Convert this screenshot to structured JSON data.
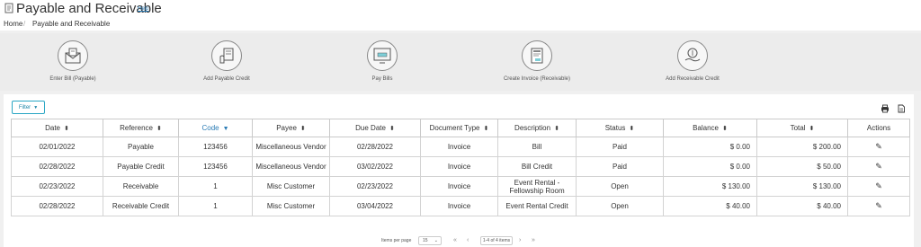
{
  "header": {
    "title": "Payable and Receivable",
    "help_label": "Help"
  },
  "breadcrumb": {
    "home": "Home",
    "separator": "/",
    "current": "Payable and Receivable"
  },
  "quick_actions": [
    {
      "label": "Enter Bill (Payable)",
      "icon": "envelope-bill-icon"
    },
    {
      "label": "Add Payable Credit",
      "icon": "hand-card-icon"
    },
    {
      "label": "Pay Bills",
      "icon": "monitor-check-icon"
    },
    {
      "label": "Create Invoice (Receivable)",
      "icon": "invoice-icon"
    },
    {
      "label": "Add Receivable Credit",
      "icon": "hand-money-icon"
    }
  ],
  "toolbar": {
    "filter_label": "Filter",
    "print_icon": "print-icon",
    "export_icon": "export-icon"
  },
  "table": {
    "columns": [
      "Date",
      "Reference",
      "Code",
      "Payee",
      "Due Date",
      "Document Type",
      "Description",
      "Status",
      "Balance",
      "Total",
      "Actions"
    ],
    "sorted_column": "Code",
    "rows": [
      {
        "date": "02/01/2022",
        "reference": "Payable",
        "code": "123456",
        "payee": "Miscellaneous Vendor",
        "due_date": "02/28/2022",
        "doc_type": "Invoice",
        "description": "Bill",
        "status": "Paid",
        "balance": "$ 0.00",
        "total": "$ 200.00"
      },
      {
        "date": "02/28/2022",
        "reference": "Payable Credit",
        "code": "123456",
        "payee": "Miscellaneous Vendor",
        "due_date": "03/02/2022",
        "doc_type": "Invoice",
        "description": "Bill Credit",
        "status": "Paid",
        "balance": "$ 0.00",
        "total": "$ 50.00"
      },
      {
        "date": "02/23/2022",
        "reference": "Receivable",
        "code": "1",
        "payee": "Misc Customer",
        "due_date": "02/23/2022",
        "doc_type": "Invoice",
        "description": "Event Rental - Fellowship Room",
        "status": "Open",
        "balance": "$ 130.00",
        "total": "$ 130.00"
      },
      {
        "date": "02/28/2022",
        "reference": "Receivable Credit",
        "code": "1",
        "payee": "Misc Customer",
        "due_date": "03/04/2022",
        "doc_type": "Invoice",
        "description": "Event Rental Credit",
        "status": "Open",
        "balance": "$ 40.00",
        "total": "$ 40.00"
      }
    ]
  },
  "pagination": {
    "items_per_page_label": "Items per page",
    "items_per_page": "15",
    "range": "1-4 of 4 items"
  },
  "colors": {
    "accent": "#2a7bb5",
    "filter_border": "#29a6c4",
    "panel_bg": "#ececec"
  }
}
